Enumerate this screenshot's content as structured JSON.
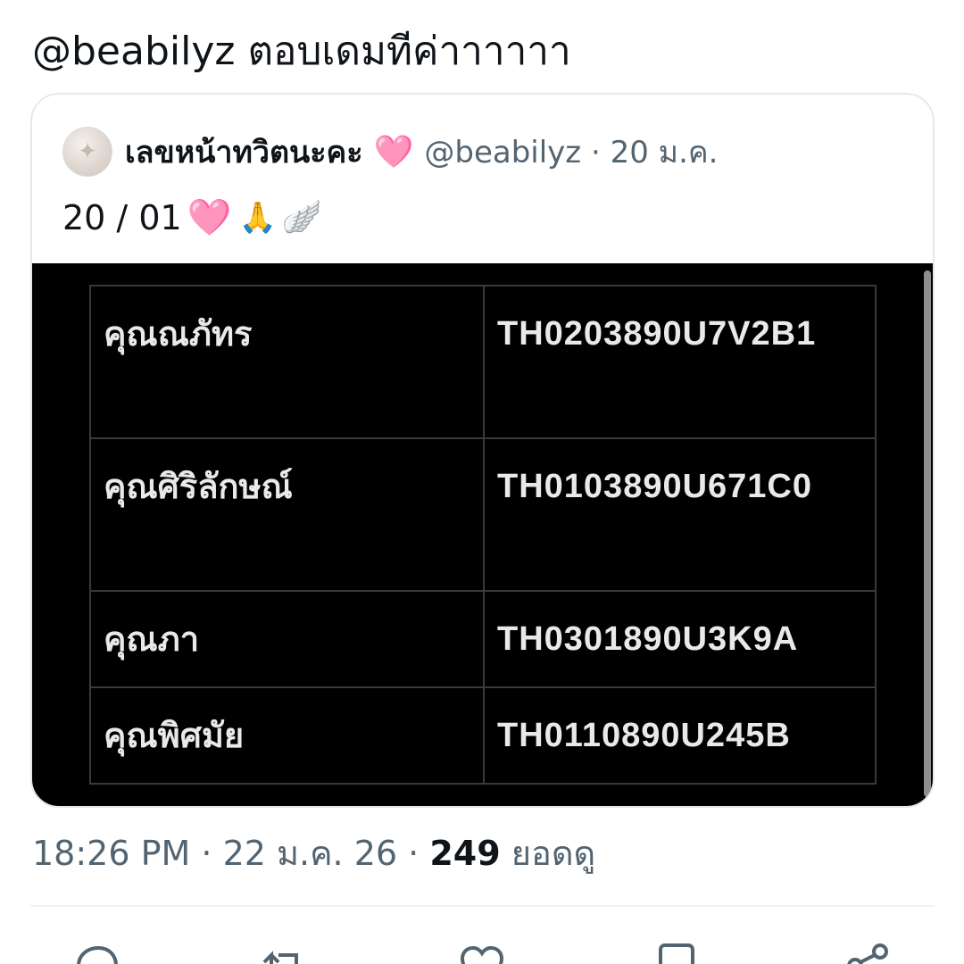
{
  "reply": {
    "text": "@beabilyz ตอบเดมทีค่าาาาาา"
  },
  "quote": {
    "avatar_icon": "avatar-image",
    "display_name": "เลขหน้าทวิตนะคะ",
    "name_emoji": "🩷",
    "handle": "@beabilyz",
    "separator": "·",
    "date": "20 ม.ค.",
    "body_text": "20 / 01",
    "body_emojis": [
      "🩷",
      "🙏",
      "🪽"
    ],
    "table_rows": [
      {
        "name": "คุณณภัทร",
        "code": "TH0203890U7V2B1"
      },
      {
        "name": "คุณศิริลักษณ์",
        "code": "TH0103890U671C0"
      },
      {
        "name": "คุณภา",
        "code": "TH0301890U3K9A"
      },
      {
        "name": "คุณพิศมัย",
        "code": "TH0110890U245B"
      }
    ]
  },
  "meta": {
    "time": "18:26 PM",
    "separator": "·",
    "date": "22 ม.ค. 26",
    "views_count": "249",
    "views_label": "ยอดดู"
  },
  "actions": {
    "icons": [
      "reply-icon",
      "repost-icon",
      "like-icon",
      "bookmark-icon",
      "share-icon"
    ]
  },
  "colors": {
    "text_primary": "#0f1419",
    "text_secondary": "#536471",
    "border": "#e6e9ec",
    "media_bg": "#000000",
    "table_text": "#e9e9e9"
  }
}
